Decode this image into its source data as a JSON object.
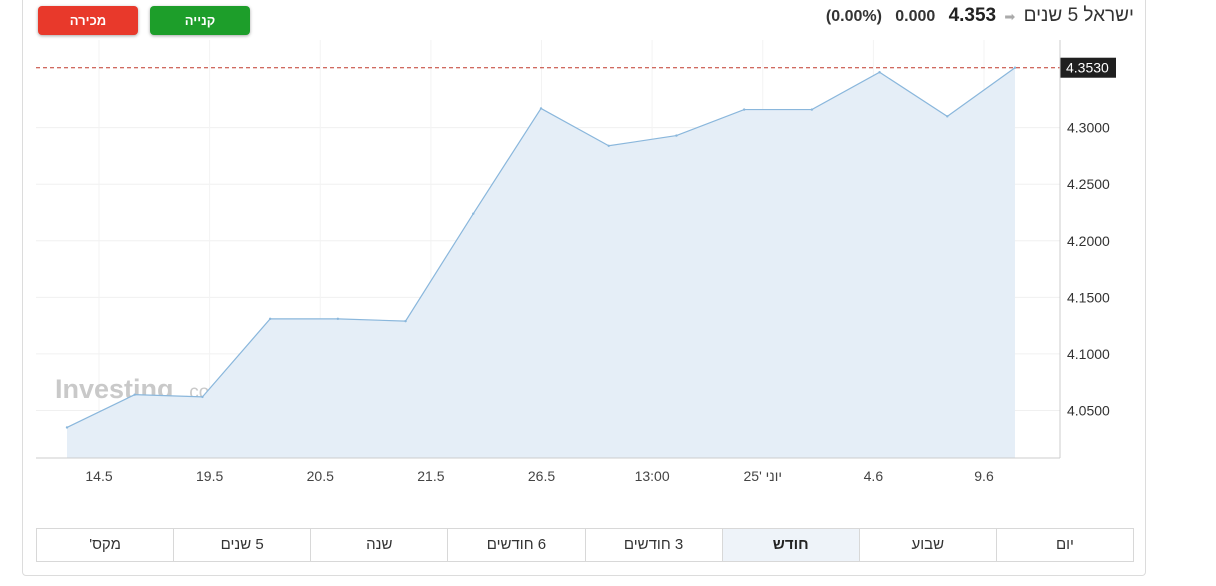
{
  "header": {
    "instrument": "ישראל 5 שנים",
    "price": "4.353",
    "change": "0.000",
    "change_pct": "(0.00%)",
    "arrow_icon": "neutral-arrow-icon"
  },
  "buttons": {
    "sell": "מכירה",
    "buy": "קנייה"
  },
  "colors": {
    "sell": "#e8392b",
    "buy": "#1d9e2a",
    "line": "#8ab7dc",
    "area": "#e5eef7",
    "last_price_line": "#c0392b",
    "last_price_badge": "#1f1f1f"
  },
  "watermark": {
    "brand": "Investing",
    "suffix": ".com"
  },
  "chart_data": {
    "type": "area",
    "x_tick_labels": [
      "14.5",
      "19.5",
      "20.5",
      "21.5",
      "26.5",
      "13:00",
      "יוני '25",
      "4.6",
      "9.6"
    ],
    "y_ticks": [
      4.05,
      4.1,
      4.15,
      4.2,
      4.25,
      4.3
    ],
    "y_tick_labels": [
      "4.0500",
      "4.1000",
      "4.1500",
      "4.2000",
      "4.2500",
      "4.3000"
    ],
    "ylim": [
      4.008,
      4.3775
    ],
    "last_price": 4.353,
    "last_price_label": "4.3530",
    "grid": true,
    "series": [
      {
        "values": [
          4.035,
          4.064,
          4.062,
          4.131,
          4.131,
          4.129,
          4.224,
          4.317,
          4.284,
          4.293,
          4.316,
          4.316,
          4.349,
          4.31,
          4.353
        ]
      }
    ]
  },
  "timeframes": [
    {
      "label": "יום",
      "active": false
    },
    {
      "label": "שבוע",
      "active": false
    },
    {
      "label": "חודש",
      "active": true
    },
    {
      "label": "3 חודשים",
      "active": false
    },
    {
      "label": "6 חודשים",
      "active": false
    },
    {
      "label": "שנה",
      "active": false
    },
    {
      "label": "5 שנים",
      "active": false
    },
    {
      "label": "מקס'",
      "active": false
    }
  ]
}
